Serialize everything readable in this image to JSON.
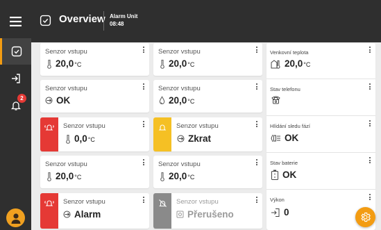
{
  "header": {
    "title": "Overview",
    "unit_name": "Alarm Unit",
    "time": "08:48"
  },
  "sidebar": {
    "menu_icon": "hamburger-icon",
    "items": [
      {
        "icon": "overview-icon",
        "active": true
      },
      {
        "icon": "logout-icon",
        "active": false
      },
      {
        "icon": "bell-icon",
        "active": false,
        "badge": "2"
      }
    ]
  },
  "colors": {
    "accent": "#f39c12",
    "alarm": "#e53935",
    "warning": "#f5c024",
    "disabled": "#8a8a8a",
    "dark": "#2f2f2f"
  },
  "cards": [
    {
      "label": "Senzor vstupu",
      "value": "20,0",
      "unit": "°C",
      "icon": "thermometer-icon"
    },
    {
      "label": "Senzor vstupu",
      "value": "20,0",
      "unit": "°C",
      "icon": "thermometer-icon"
    },
    {
      "label": "Senzor vstupu",
      "value": "OK",
      "unit": "",
      "icon": "switch-state-icon"
    },
    {
      "label": "Senzor vstupu",
      "value": "20,0",
      "unit": "°C",
      "icon": "humidity-drop-icon"
    },
    {
      "label": "Senzor vstupu",
      "value": "0,0",
      "unit": "°C",
      "icon": "thermometer-icon",
      "status": "alarm",
      "status_icon": "ringing-alarm-icon"
    },
    {
      "label": "Senzor vstupu",
      "value": "Zkrat",
      "unit": "",
      "icon": "switch-state-icon",
      "status": "warning",
      "status_icon": "bell-icon"
    },
    {
      "label": "Senzor vstupu",
      "value": "20,0",
      "unit": "°C",
      "icon": "thermometer-icon"
    },
    {
      "label": "Senzor vstupu",
      "value": "20,0",
      "unit": "°C",
      "icon": "thermometer-icon"
    },
    {
      "label": "Senzor vstupu",
      "value": "Alarm",
      "unit": "",
      "icon": "switch-state-icon",
      "status": "alarm",
      "status_icon": "ringing-alarm-icon"
    },
    {
      "label": "Senzor vstupu",
      "value": "Přerušeno",
      "unit": "",
      "icon": "disconnected-icon",
      "status": "disabled",
      "status_icon": "bell-off-icon"
    }
  ],
  "right_panel": [
    {
      "label": "Venkovní teplota",
      "value": "20,0",
      "unit": "°C",
      "icon": "outdoor-thermometer-icon"
    },
    {
      "label": "Stav telefonu",
      "value": "",
      "unit": "",
      "icon": "phone-icon"
    },
    {
      "label": "Hlídání sledu fází",
      "value": "OK",
      "unit": "",
      "icon": "phase-sequence-icon"
    },
    {
      "label": "Stav baterie",
      "value": "OK",
      "unit": "",
      "icon": "battery-icon"
    },
    {
      "label": "Výkon",
      "value": "0",
      "unit": "",
      "icon": "power-input-icon"
    }
  ],
  "fab": {
    "icon": "settings-gear-icon"
  }
}
